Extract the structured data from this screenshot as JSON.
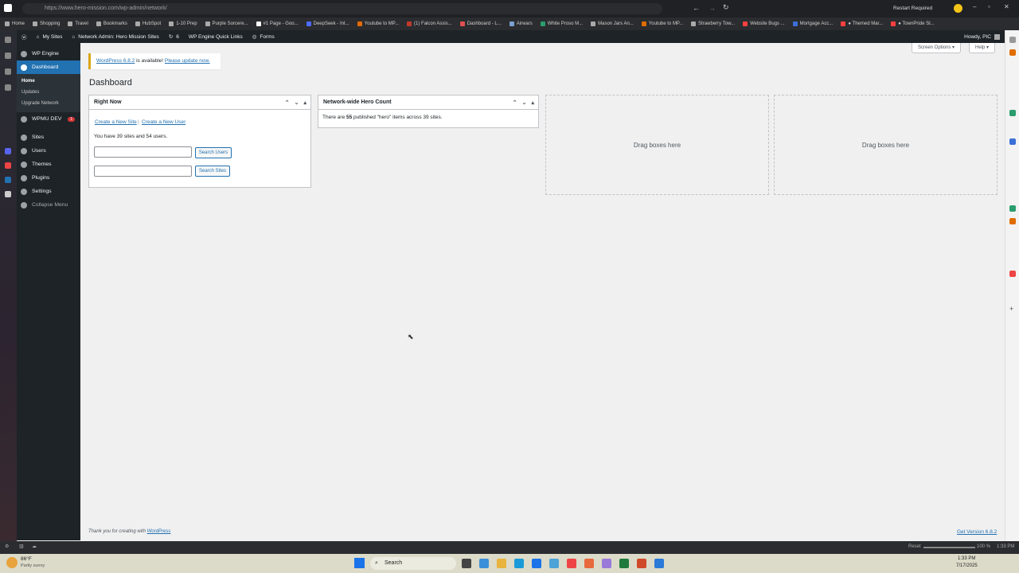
{
  "browser": {
    "url": "https://www.hero-mission.com/wp-admin/network/",
    "restart_label": "Restart Required",
    "bookmarks": [
      {
        "label": "Home",
        "color": "#aaaaaa"
      },
      {
        "label": "Shopping",
        "color": "#aaaaaa"
      },
      {
        "label": "Travel",
        "color": "#aaaaaa"
      },
      {
        "label": "Bookmarks",
        "color": "#aaaaaa"
      },
      {
        "label": "HubSpot",
        "color": "#aaaaaa"
      },
      {
        "label": "1-10 Prep",
        "color": "#aaaaaa"
      },
      {
        "label": "Purple Sorcere...",
        "color": "#aaaaaa"
      },
      {
        "label": "#1 Page - Goo...",
        "color": "#ffffff"
      },
      {
        "label": "DeepSeek - Int...",
        "color": "#4d6bfe"
      },
      {
        "label": "Youtube to MP...",
        "color": "#e06c00"
      },
      {
        "label": "(1) Falcon Assis...",
        "color": "#c0392b"
      },
      {
        "label": "Dashboard - L...",
        "color": "#e05050"
      },
      {
        "label": "Airwars",
        "color": "#7aa0d0"
      },
      {
        "label": "White Proso M...",
        "color": "#2a9d6c"
      },
      {
        "label": "Mason Jars An...",
        "color": "#aaaaaa"
      },
      {
        "label": "Youtube to MP...",
        "color": "#e06c00"
      },
      {
        "label": "Strawberry Tow...",
        "color": "#aaaaaa"
      },
      {
        "label": "Website Bugs ...",
        "color": "#ff4040"
      },
      {
        "label": "Mortgage Acc...",
        "color": "#3a6fd8"
      },
      {
        "label": "● Themed Mar...",
        "color": "#ff4040"
      },
      {
        "label": "● TownPride St...",
        "color": "#ff4040"
      }
    ],
    "bottom_reset": "Reset",
    "bottom_zoom": "100 %",
    "bottom_time": "1:33 PM"
  },
  "adminbar": {
    "my_sites": "My Sites",
    "network_admin": "Network Admin: Hero Mission Sites",
    "updates_count": "6",
    "quick_links": "WP Engine Quick Links",
    "forms": "Forms",
    "howdy": "Howdy, PIC"
  },
  "menu": {
    "wp_engine": "WP Engine",
    "dashboard": "Dashboard",
    "sub_home": "Home",
    "sub_updates": "Updates",
    "sub_upgrade": "Upgrade Network",
    "wpmu_dev": "WPMU DEV",
    "wpmu_badge": "1",
    "sites": "Sites",
    "users": "Users",
    "themes": "Themes",
    "plugins": "Plugins",
    "settings": "Settings",
    "collapse": "Collapse Menu"
  },
  "notice": {
    "version_link": "WordPress 6.8.2",
    "middle": " is available! ",
    "update_link": "Please update now."
  },
  "screen_options": "Screen Options ▾",
  "help": "Help ▾",
  "page_title": "Dashboard",
  "right_now": {
    "title": "Right Now",
    "create_site": "Create a New Site",
    "separator": "|",
    "create_user": "Create a New User",
    "summary": "You have 39 sites and 54 users.",
    "search_users": "Search Users",
    "search_sites": "Search Sites"
  },
  "hero_count": {
    "title": "Network-wide Hero Count",
    "text_pre": "There are ",
    "count": "55",
    "text_post": " published \"hero\" items across 39 sites."
  },
  "drag_boxes": "Drag boxes here",
  "footer": {
    "thanks": "Thank you for creating with ",
    "wp_link": "WordPress",
    "version": "Get Version 6.8.2"
  },
  "taskbar": {
    "weather_temp": "86°F",
    "weather_desc": "Partly sunny",
    "search": "Search",
    "time": "1:33 PM",
    "date": "7/17/2025"
  }
}
